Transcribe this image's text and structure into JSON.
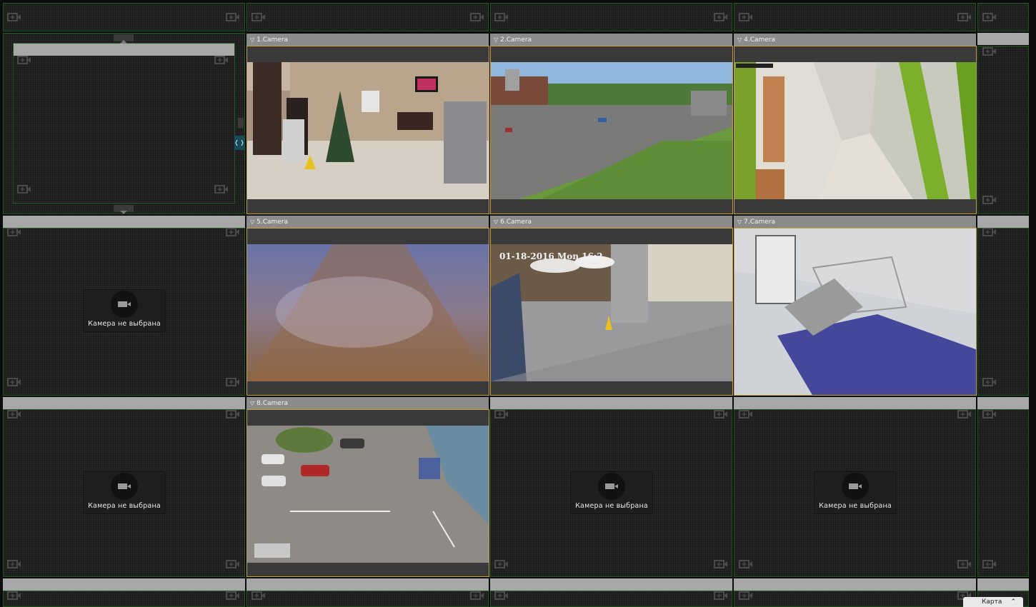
{
  "cameras": [
    {
      "label": "1.Camera"
    },
    {
      "label": "2.Camera"
    },
    {
      "label": "4.Camera"
    },
    {
      "label": "5.Camera"
    },
    {
      "label": "6.Camera"
    },
    {
      "label": "7.Camera"
    },
    {
      "label": "8.Camera"
    }
  ],
  "placeholder_text": "Камера не выбрана",
  "overlays": {
    "cam6_timestamp": "01-18-2016  Mon  16:2"
  },
  "map_button": {
    "label": "Карта",
    "icon": "chevron-up-double-icon"
  },
  "colors": {
    "cell_border": "#1f5a1f",
    "camera_border": "#c9a23a",
    "header_bg": "#8b8b8b",
    "strip_bg": "#a7a7a7"
  },
  "icons": {
    "corner": "add-camera-icon",
    "filter": "filter-icon",
    "placeholder": "camera-icon"
  }
}
